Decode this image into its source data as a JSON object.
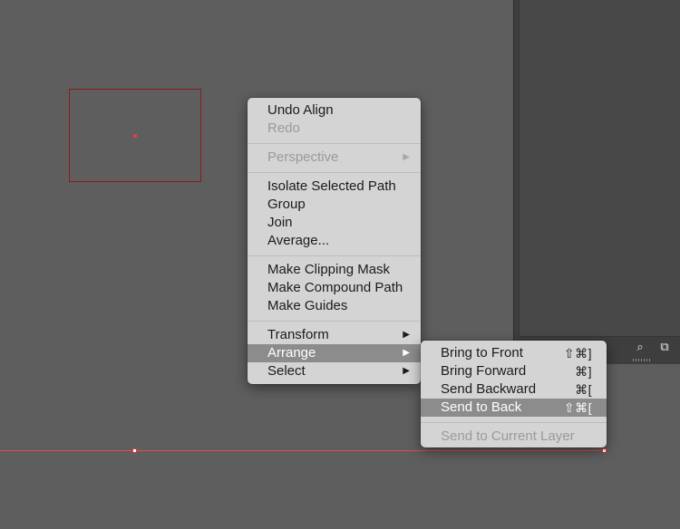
{
  "context_menu": {
    "groups": [
      [
        {
          "label": "Undo Align",
          "enabled": true
        },
        {
          "label": "Redo",
          "enabled": false
        }
      ],
      [
        {
          "label": "Perspective",
          "enabled": false,
          "submenu_arrow": "▶"
        }
      ],
      [
        {
          "label": "Isolate Selected Path",
          "enabled": true
        },
        {
          "label": "Group",
          "enabled": true
        },
        {
          "label": "Join",
          "enabled": true
        },
        {
          "label": "Average...",
          "enabled": true
        }
      ],
      [
        {
          "label": "Make Clipping Mask",
          "enabled": true
        },
        {
          "label": "Make Compound Path",
          "enabled": true
        },
        {
          "label": "Make Guides",
          "enabled": true
        }
      ],
      [
        {
          "label": "Transform",
          "enabled": true,
          "submenu_arrow": "▶"
        },
        {
          "label": "Arrange",
          "enabled": true,
          "submenu_arrow": "▶",
          "highlighted": true
        },
        {
          "label": "Select",
          "enabled": true,
          "submenu_arrow": "▶"
        }
      ]
    ]
  },
  "arrange_submenu": {
    "items": [
      {
        "label": "Bring to Front",
        "shortcut": "⇧⌘]"
      },
      {
        "label": "Bring Forward",
        "shortcut": "⌘]"
      },
      {
        "label": "Send Backward",
        "shortcut": "⌘["
      },
      {
        "label": "Send to Back",
        "shortcut": "⇧⌘[",
        "highlighted": true
      }
    ],
    "disabled_item": {
      "label": "Send to Current Layer"
    }
  },
  "panel": {
    "search_icon": "search-icon",
    "new_icon": "new-layer-icon",
    "search_glyph": "⌕",
    "new_glyph": "⧉"
  },
  "colors": {
    "canvas": "#5e5e5e",
    "menu_bg": "#d4d4d4",
    "highlight": "#8c8c8c",
    "selection": "#e24a4a"
  }
}
